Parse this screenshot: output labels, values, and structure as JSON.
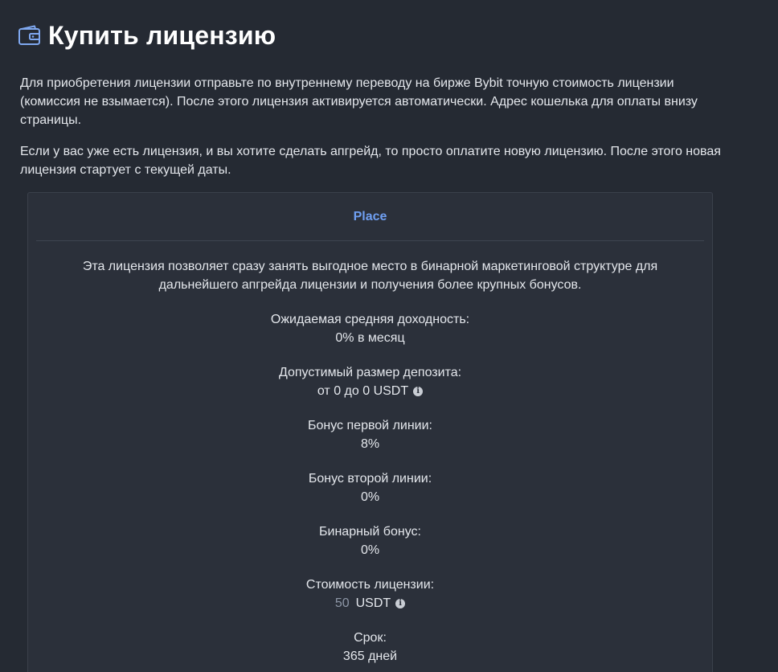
{
  "header": {
    "title": "Купить лицензию",
    "icon": "wallet-icon"
  },
  "intro": {
    "p1": "Для приобретения лицензии отправьте по внутреннему переводу на бирже Bybit точную стоимость лицензии (комиссия не взымается). После этого лицензия активируется автоматически. Адрес кошелька для оплаты внизу страницы.",
    "p2": "Если у вас уже есть лицензия, и вы хотите сделать апгрейд, то просто оплатите новую лицензию. После этого новая лицензия стартует с текущей даты."
  },
  "license": {
    "name": "Place",
    "description": "Эта лицензия позволяет сразу занять выгодное место в бинарной маркетинговой структуре для дальнейшего апгрейда лицензии и получения более крупных бонусов.",
    "yield_label": "Ожидаемая средняя доходность:",
    "yield_value": "0% в месяц",
    "deposit_label": "Допустимый размер депозита:",
    "deposit_value": "от 0 до 0 USDT",
    "first_line_label": "Бонус первой линии:",
    "first_line_value": "8%",
    "second_line_label": "Бонус второй линии:",
    "second_line_value": "0%",
    "binary_label": "Бинарный бонус:",
    "binary_value": "0%",
    "price_label": "Стоимость лицензии:",
    "price_amount": "50",
    "price_currency": "USDT",
    "term_label": "Срок:",
    "term_value": "365 дней"
  },
  "colors": {
    "background": "#252a33",
    "card": "#2b303a",
    "accent": "#6f9ff2"
  }
}
